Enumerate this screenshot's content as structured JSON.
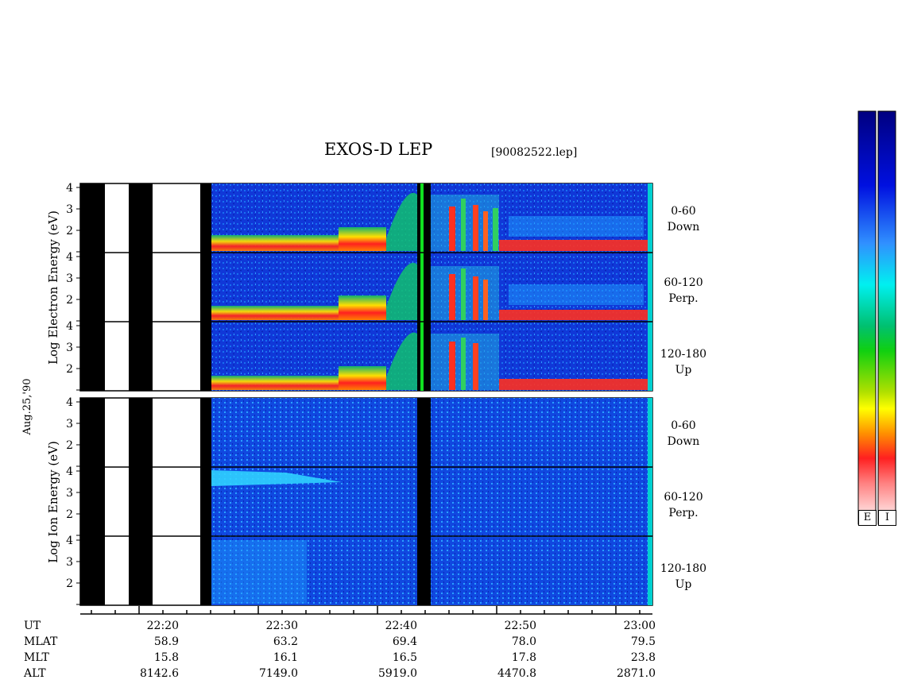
{
  "title": "EXOS-D LEP",
  "file_label": "[90082522.lep]",
  "date_label": "Aug.25,'90",
  "electron_axis_label": "Log  Electron  Energy (eV)",
  "ion_axis_label": "Log  Ion  Energy (eV)",
  "pitch_labels": [
    {
      "range": "0-60",
      "dir": "Down"
    },
    {
      "range": "60-120",
      "dir": "Perp."
    },
    {
      "range": "120-180",
      "dir": "Up"
    }
  ],
  "colorbar_labels": [
    "E",
    "I"
  ],
  "colors": {
    "background_spectrogram": "#1030c8",
    "hot": "#e81010",
    "mid": "#10c860",
    "cold": "#000080"
  },
  "chart_data": {
    "type": "heatmap",
    "title": "EXOS-D LEP",
    "subtitle": "[90082522.lep]",
    "xlabel": "UT",
    "x_ticks": [
      "22:20",
      "22:30",
      "22:40",
      "22:50",
      "23:00"
    ],
    "y_ticks": [
      "4",
      "3",
      "2"
    ],
    "y_ticks_up": [
      "4",
      "3",
      "2"
    ],
    "panels": [
      {
        "species": "Electron",
        "pitch": "0-60",
        "dir": "Down"
      },
      {
        "species": "Electron",
        "pitch": "60-120",
        "dir": "Perp."
      },
      {
        "species": "Electron",
        "pitch": "120-180",
        "dir": "Up"
      },
      {
        "species": "Ion",
        "pitch": "0-60",
        "dir": "Down"
      },
      {
        "species": "Ion",
        "pitch": "60-120",
        "dir": "Perp."
      },
      {
        "species": "Ion",
        "pitch": "120-180",
        "dir": "Up"
      }
    ],
    "ephemeris": {
      "rows": [
        {
          "name": "UT",
          "values": [
            "22:20",
            "22:30",
            "22:40",
            "22:50",
            "23:00"
          ]
        },
        {
          "name": "MLAT",
          "values": [
            "58.9",
            "63.2",
            "69.4",
            "78.0",
            "79.5"
          ]
        },
        {
          "name": "MLT",
          "values": [
            "15.8",
            "16.1",
            "16.5",
            "17.8",
            "23.8"
          ]
        },
        {
          "name": "ALT",
          "values": [
            "8142.6",
            "7149.0",
            "5919.0",
            "4470.8",
            "2871.0"
          ]
        }
      ]
    }
  }
}
